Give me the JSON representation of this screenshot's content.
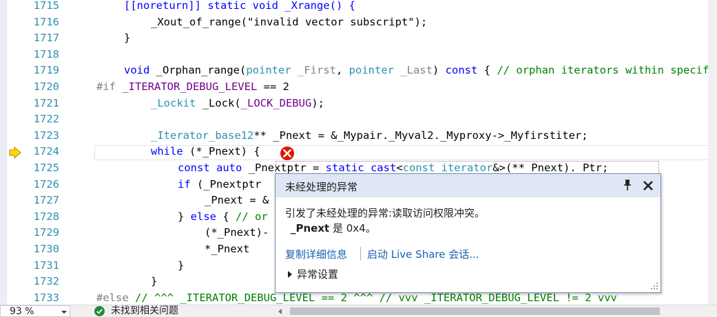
{
  "editor": {
    "line_numbers": [
      "1715",
      "1716",
      "1717",
      "1718",
      "1719",
      "1720",
      "1721",
      "1722",
      "1723",
      "1724",
      "1725",
      "1726",
      "1727",
      "1728",
      "1729",
      "1730",
      "1731",
      "1732",
      "1733"
    ],
    "code": {
      "l1715": "[[noreturn]] static void _Xrange() {",
      "l1716": "_Xout_of_range(\"invalid vector subscript\");",
      "l1717": "}",
      "l1719_a": "void ",
      "l1719_b": "_Orphan_range(",
      "l1719_c": "pointer",
      "l1719_d": " _First",
      "l1719_e": ", ",
      "l1719_f": "pointer",
      "l1719_g": " _Last",
      "l1719_h": ") ",
      "l1719_i": "const",
      "l1719_j": " { ",
      "l1719_k": "// orphan iterators within specified (inclusive) range",
      "l1720_a": "#if ",
      "l1720_b": "_ITERATOR_DEBUG_LEVEL",
      "l1720_c": " == 2",
      "l1721_a": "_Lockit",
      "l1721_b": " _Lock(",
      "l1721_c": "_LOCK_DEBUG",
      "l1721_d": ");",
      "l1723_a": "_Iterator_base12",
      "l1723_b": "** _Pnext = &_Mypair._Myval2._Myproxy->_Myfirstiter;",
      "l1724_a": "while",
      "l1724_b": " (*_Pnext) {",
      "l1725_a": "const auto",
      "l1725_b": " _Pnextptr = ",
      "l1725_c": "static_cast",
      "l1725_d": "<",
      "l1725_e": "const_iterator",
      "l1725_f": "&>(**_Pnext)._Ptr;",
      "l1726_a": "if",
      "l1726_b": " (_Pnextptr",
      "l1727": "_Pnext = &",
      "l1728_a": "} ",
      "l1728_b": "else",
      "l1728_c": " { ",
      "l1728_d": "// or",
      "l1729": "(*_Pnext)-",
      "l1730": "*_Pnext",
      "l1731": "}",
      "l1732": "}",
      "l1733_a": "#else ",
      "l1733_b": "// ^^^ _ITERATOR_DEBUG_LEVEL == 2 ^^^ // vvv _ITERATOR_DEBUG_LEVEL != 2 vvv"
    }
  },
  "exception_popup": {
    "title": "未经处理的异常",
    "message": "引发了未经处理的异常:读取访问权限冲突。",
    "detail_var": "_Pnext",
    "detail_rest": " 是 0x4。",
    "link_copy": "复制详细信息",
    "link_liveshare": "启动 Live Share 会话...",
    "exception_settings": "异常设置",
    "pin_icon": "pin-icon",
    "close_icon": "close-icon"
  },
  "statusbar": {
    "zoom": "93 %",
    "issues": "未找到相关问题"
  },
  "colors": {
    "keyword": "#0000ff",
    "type": "#2b91af",
    "macro": "#6f008a",
    "comment": "#008000",
    "string": "#a31515",
    "error": "#e51400",
    "link": "#1a5fb4"
  }
}
